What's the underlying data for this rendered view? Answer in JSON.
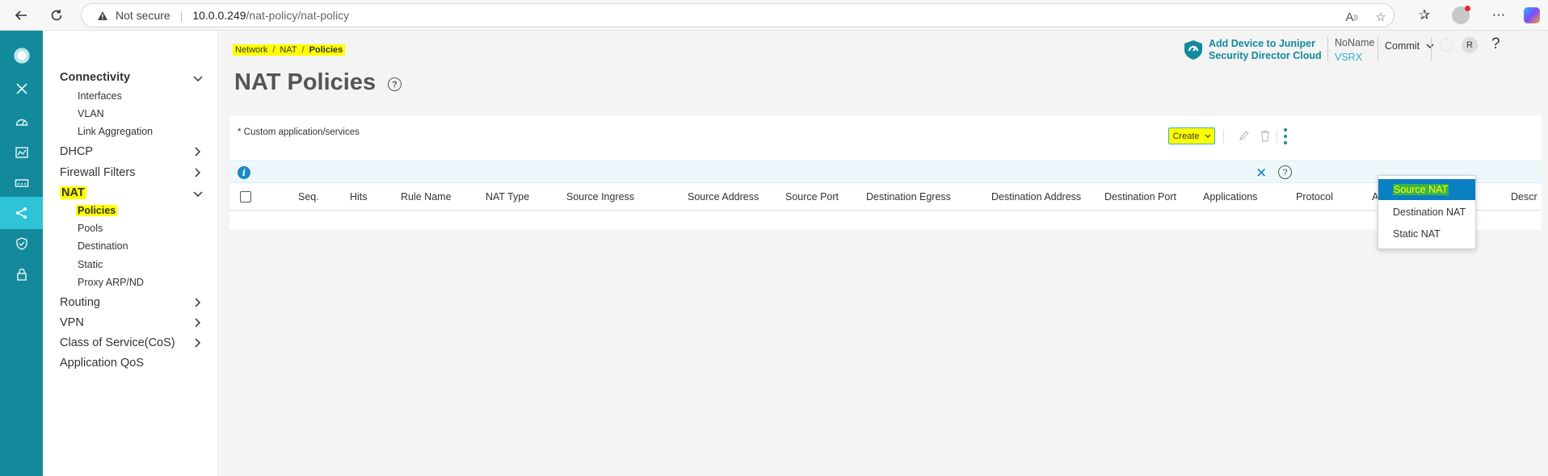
{
  "browser": {
    "not_secure": "Not secure",
    "url_host": "10.0.0.249",
    "url_path": "/nat-policy/nat-policy"
  },
  "sidenav": {
    "groups": [
      {
        "label": "Connectivity",
        "items": [
          "Interfaces",
          "VLAN",
          "Link Aggregation"
        ]
      },
      {
        "label": "DHCP"
      },
      {
        "label": "Firewall Filters"
      },
      {
        "label": "NAT",
        "items": [
          "Policies",
          "Pools",
          "Destination",
          "Static",
          "Proxy ARP/ND"
        ]
      },
      {
        "label": "Routing"
      },
      {
        "label": "VPN"
      },
      {
        "label": "Class of Service(CoS)"
      },
      {
        "label": "Application QoS"
      }
    ]
  },
  "breadcrumb": [
    "Network",
    "NAT",
    "Policies"
  ],
  "page": {
    "title": "NAT Policies",
    "help": "?"
  },
  "header": {
    "jsd_line1": "Add Device to Juniper",
    "jsd_line2": "Security Director Cloud",
    "device_name": "NoName",
    "device_model": "VSRX",
    "commit_label": "Commit",
    "user_initial": "R",
    "help": "?"
  },
  "card": {
    "note": "* Custom application/services",
    "create_label": "Create",
    "info_glyph": "i",
    "columns": [
      "Seq.",
      "Hits",
      "Rule Name",
      "NAT Type",
      "Source Ingress",
      "Source Address",
      "Source Port",
      "Destination Egress",
      "Destination Address",
      "Destination Port",
      "Applications",
      "Protocol",
      "A",
      "Descr"
    ]
  },
  "create_menu": {
    "items": [
      "Source NAT",
      "Destination NAT",
      "Static NAT"
    ],
    "selected": "Source NAT"
  },
  "colors": {
    "rail": "#138a9c",
    "rail_active": "#2fc3d6",
    "accent": "#138a9c",
    "highlight": "#ffff00",
    "menu_active": "#0a7fc2"
  }
}
